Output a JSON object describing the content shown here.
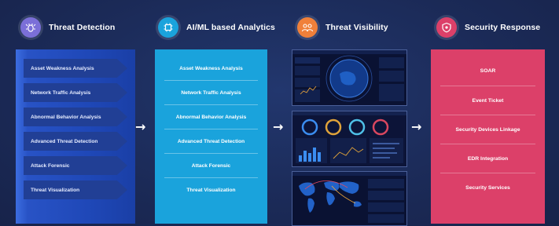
{
  "columns": [
    {
      "title": "Threat Detection",
      "color": "#7b6fd8",
      "icon": "bug-shield-icon"
    },
    {
      "title": "AI/ML based Analytics",
      "color": "#1aa3dc",
      "icon": "ai-chip-icon"
    },
    {
      "title": "Threat Visibility",
      "color": "#f0803a",
      "icon": "people-visibility-icon"
    },
    {
      "title": "Security Response",
      "color": "#dc4069",
      "icon": "shield-response-icon"
    }
  ],
  "threat_detection": {
    "items": [
      "Asset Weakness Analysis",
      "Network Traffic Analysis",
      "Abnormal Behavior Analysis",
      "Advanced Threat Detection",
      "Attack Forensic",
      "Threat Visualization"
    ]
  },
  "analytics": {
    "items": [
      "Asset Weakness Analysis",
      "Network Traffic Analysis",
      "Abnormal Behavior Analysis",
      "Advanced Threat Detection",
      "Attack Forensic",
      "Threat Visualization"
    ]
  },
  "visibility": {
    "screens": [
      "globe-dashboard",
      "metrics-dashboard",
      "world-map-dashboard"
    ]
  },
  "response": {
    "items": [
      "SOAR",
      "Event Ticket",
      "Security Devices Linkage",
      "EDR Integration",
      "Security Services"
    ]
  },
  "arrows": [
    "→",
    "→",
    "→"
  ]
}
